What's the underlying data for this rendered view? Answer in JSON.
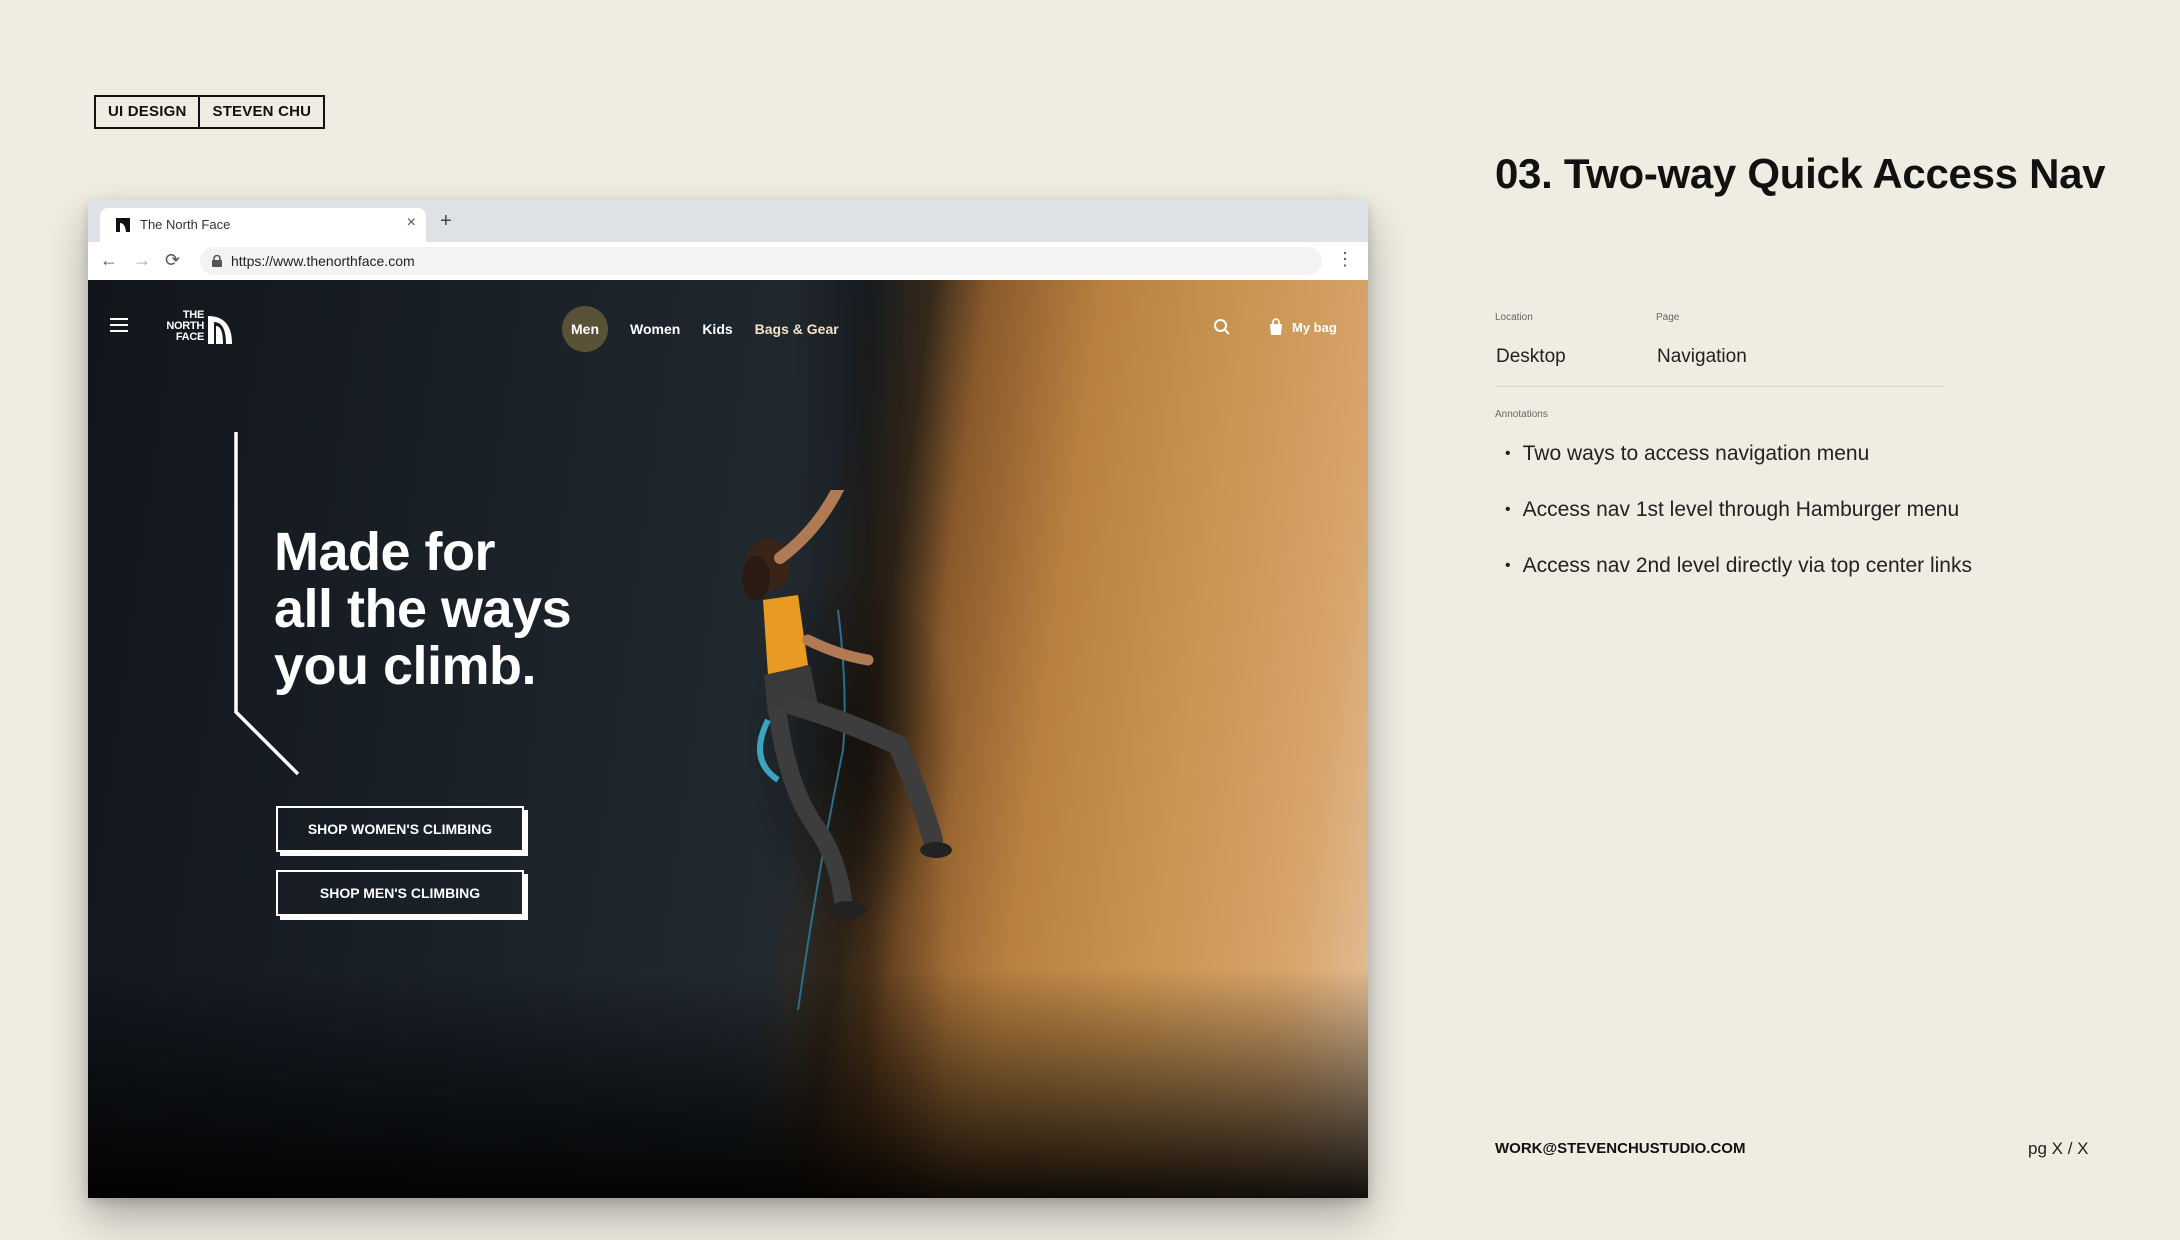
{
  "tags": [
    "UI DESIGN",
    "STEVEN CHU"
  ],
  "browser": {
    "tab_title": "The North Face",
    "tab_close": "×",
    "new_tab": "+",
    "back": "←",
    "forward": "→",
    "reload": "⟳",
    "url": "https://www.thenorthface.com",
    "menu": "⋮"
  },
  "site": {
    "logo_lines": [
      "THE",
      "NORTH",
      "FACE"
    ],
    "nav": [
      "Men",
      "Women",
      "Kids",
      "Bags & Gear"
    ],
    "bag_label": "My bag",
    "headline": [
      "Made for",
      "all the ways",
      "you climb."
    ],
    "cta_women": "SHOP WOMEN'S CLIMBING",
    "cta_men": "SHOP MEN'S CLIMBING"
  },
  "panel": {
    "title": "03. Two-way Quick Access Nav",
    "location_label": "Location",
    "location_value": "Desktop",
    "page_label": "Page",
    "page_value": "Navigation",
    "annotations_label": "Annotations",
    "bullet": "•",
    "annotations": [
      "Two ways to access navigation menu",
      "Access nav 1st level through Hamburger menu",
      "Access nav 2nd level directly via top center links"
    ]
  },
  "footer": {
    "email": "WORK@STEVENCHUSTUDIO.COM",
    "page": "pg X / X"
  }
}
